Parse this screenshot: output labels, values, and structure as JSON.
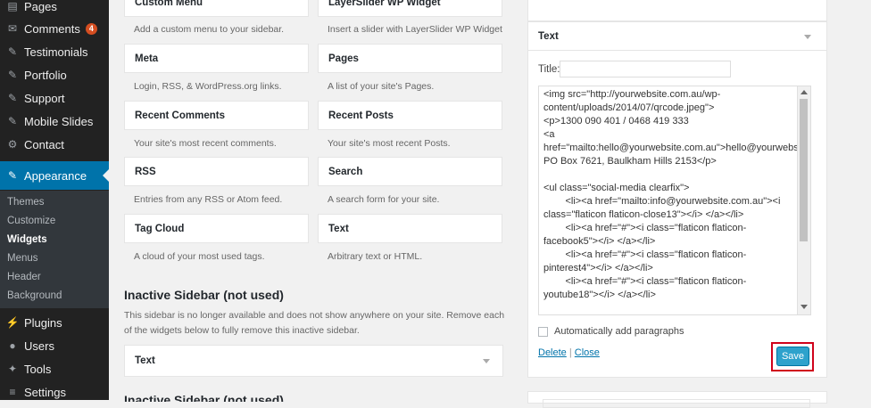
{
  "sidebar": {
    "items": [
      {
        "label": "Pages",
        "icon": "pages-icon",
        "glyph": "▤"
      },
      {
        "label": "Comments",
        "icon": "comments-icon",
        "glyph": "✉",
        "badge": "4"
      },
      {
        "label": "Testimonials",
        "icon": "pin-icon",
        "glyph": "✎"
      },
      {
        "label": "Portfolio",
        "icon": "pin-icon",
        "glyph": "✎"
      },
      {
        "label": "Support",
        "icon": "pin-icon",
        "glyph": "✎"
      },
      {
        "label": "Mobile Slides",
        "icon": "pin-icon",
        "glyph": "✎"
      },
      {
        "label": "Contact",
        "icon": "gear-icon",
        "glyph": "⚙"
      },
      {
        "label": "Appearance",
        "icon": "brush-icon",
        "glyph": "✎"
      },
      {
        "label": "Plugins",
        "icon": "plug-icon",
        "glyph": "⚡"
      },
      {
        "label": "Users",
        "icon": "user-icon",
        "glyph": "●"
      },
      {
        "label": "Tools",
        "icon": "wrench-icon",
        "glyph": "✦"
      },
      {
        "label": "Settings",
        "icon": "sliders-icon",
        "glyph": "≡"
      }
    ],
    "submenu": [
      {
        "label": "Themes"
      },
      {
        "label": "Customize"
      },
      {
        "label": "Widgets"
      },
      {
        "label": "Menus"
      },
      {
        "label": "Header"
      },
      {
        "label": "Background"
      }
    ]
  },
  "widgets": [
    {
      "title": "Custom Menu",
      "desc": "Add a custom menu to your sidebar."
    },
    {
      "title": "LayerSlider WP Widget",
      "desc": "Insert a slider with LayerSlider WP Widget"
    },
    {
      "title": "Meta",
      "desc": "Login, RSS, & WordPress.org links."
    },
    {
      "title": "Pages",
      "desc": "A list of your site's Pages."
    },
    {
      "title": "Recent Comments",
      "desc": "Your site's most recent comments."
    },
    {
      "title": "Recent Posts",
      "desc": "Your site's most recent Posts."
    },
    {
      "title": "RSS",
      "desc": "Entries from any RSS or Atom feed."
    },
    {
      "title": "Search",
      "desc": "A search form for your site."
    },
    {
      "title": "Tag Cloud",
      "desc": "A cloud of your most used tags."
    },
    {
      "title": "Text",
      "desc": "Arbitrary text or HTML."
    }
  ],
  "inactive": {
    "title": "Inactive Sidebar (not used)",
    "desc": "This sidebar is no longer available and does not show anywhere on your site. Remove each of the widgets below to fully remove this inactive sidebar.",
    "widget": "Text",
    "next_title": "Inactive Sidebar (not used)"
  },
  "text_widget": {
    "header": "Text",
    "title_label": "Title:",
    "title_value": "",
    "content": "<img src=\"http://yourwebsite.com.au/wp-content/uploads/2014/07/qrcode.jpeg\">\n<p>1300 090 401 / 0468 419 333\n<a href=\"mailto:hello@yourwebsite.com.au\">hello@yourwebsite.com.au</a>\nPO Box 7621, Baulkham Hills 2153</p>\n\n<ul class=\"social-media clearfix\">\n        <li><a href=\"mailto:info@yourwebsite.com.au\"><i class=\"flaticon flaticon-close13\"></i> </a></li>\n        <li><a href=\"#\"><i class=\"flaticon flaticon-facebook5\"></i> </a></li>\n        <li><a href=\"#\"><i class=\"flaticon flaticon-pinterest4\"></i> </a></li>\n        <li><a href=\"#\"><i class=\"flaticon flaticon-youtube18\"></i> </a></li>",
    "auto_paragraphs_label": "Automatically add paragraphs",
    "delete_label": "Delete",
    "separator": "|",
    "close_label": "Close",
    "save_label": "Save"
  }
}
